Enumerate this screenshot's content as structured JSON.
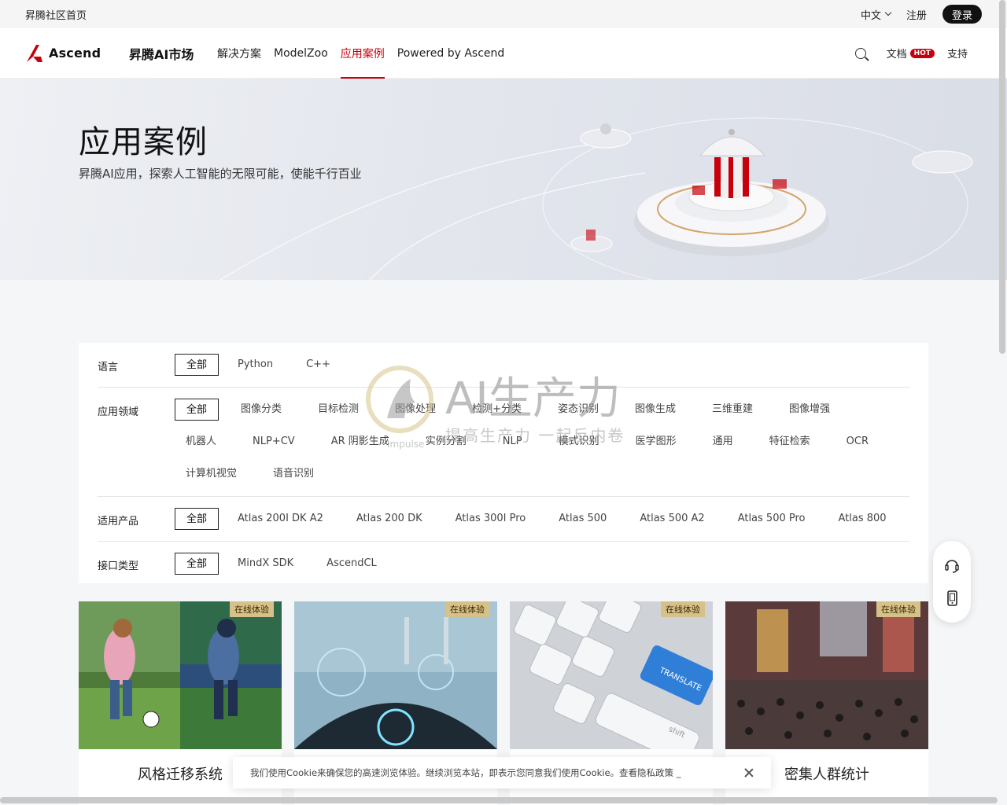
{
  "topbar": {
    "home_link": "昇腾社区首页",
    "language": "中文",
    "register": "注册",
    "login": "登录"
  },
  "nav": {
    "logo_text": "Ascend",
    "market_title": "昇腾AI市场",
    "links": [
      "解决方案",
      "ModelZoo",
      "应用案例",
      "Powered by Ascend"
    ],
    "active_index": 2,
    "docs": "文档",
    "hot_badge": "HOT",
    "support": "支持"
  },
  "hero": {
    "title": "应用案例",
    "subtitle": "昇腾AI应用，探索人工智能的无限可能，使能千行百业"
  },
  "filters": {
    "language": {
      "label": "语言",
      "options": [
        "全部",
        "Python",
        "C++"
      ]
    },
    "domain": {
      "label": "应用领域",
      "options": [
        "全部",
        "图像分类",
        "目标检测",
        "图像处理",
        "检测+分类",
        "姿态识别",
        "图像生成",
        "三维重建",
        "图像增强",
        "机器人",
        "NLP+CV",
        "AR 阴影生成",
        "实例分割",
        "NLP",
        "模式识别",
        "医学图形",
        "通用",
        "特征检索",
        "OCR",
        "计算机视觉",
        "语音识别"
      ]
    },
    "product": {
      "label": "适用产品",
      "options": [
        "全部",
        "Atlas 200I DK A2",
        "Atlas 200 DK",
        "Atlas 300I Pro",
        "Atlas 500",
        "Atlas 500 A2",
        "Atlas 500 Pro",
        "Atlas 800"
      ]
    },
    "interface": {
      "label": "接口类型",
      "options": [
        "全部",
        "MindX SDK",
        "AscendCL"
      ]
    }
  },
  "watermark": {
    "big": "AI生产力",
    "small": "提高生产力 一起反内卷",
    "brand": "Impulse"
  },
  "cards": [
    {
      "badge": "在线体验",
      "title": "风格迁移系统"
    },
    {
      "badge": "在线体验",
      "title": ""
    },
    {
      "badge": "在线体验",
      "title": ""
    },
    {
      "badge": "在线体验",
      "title": "密集人群统计"
    }
  ],
  "card_images": {
    "keyboard_key": "TRANSLATE",
    "keyboard_shift": "shift"
  },
  "cookie": {
    "text": "我们使用Cookie来确保您的高速浏览体验。继续浏览本站，即表示您同意我们使用Cookie。查看隐私政策 _"
  },
  "colors": {
    "accent": "#c7000b",
    "badge": "#d7c18a"
  }
}
